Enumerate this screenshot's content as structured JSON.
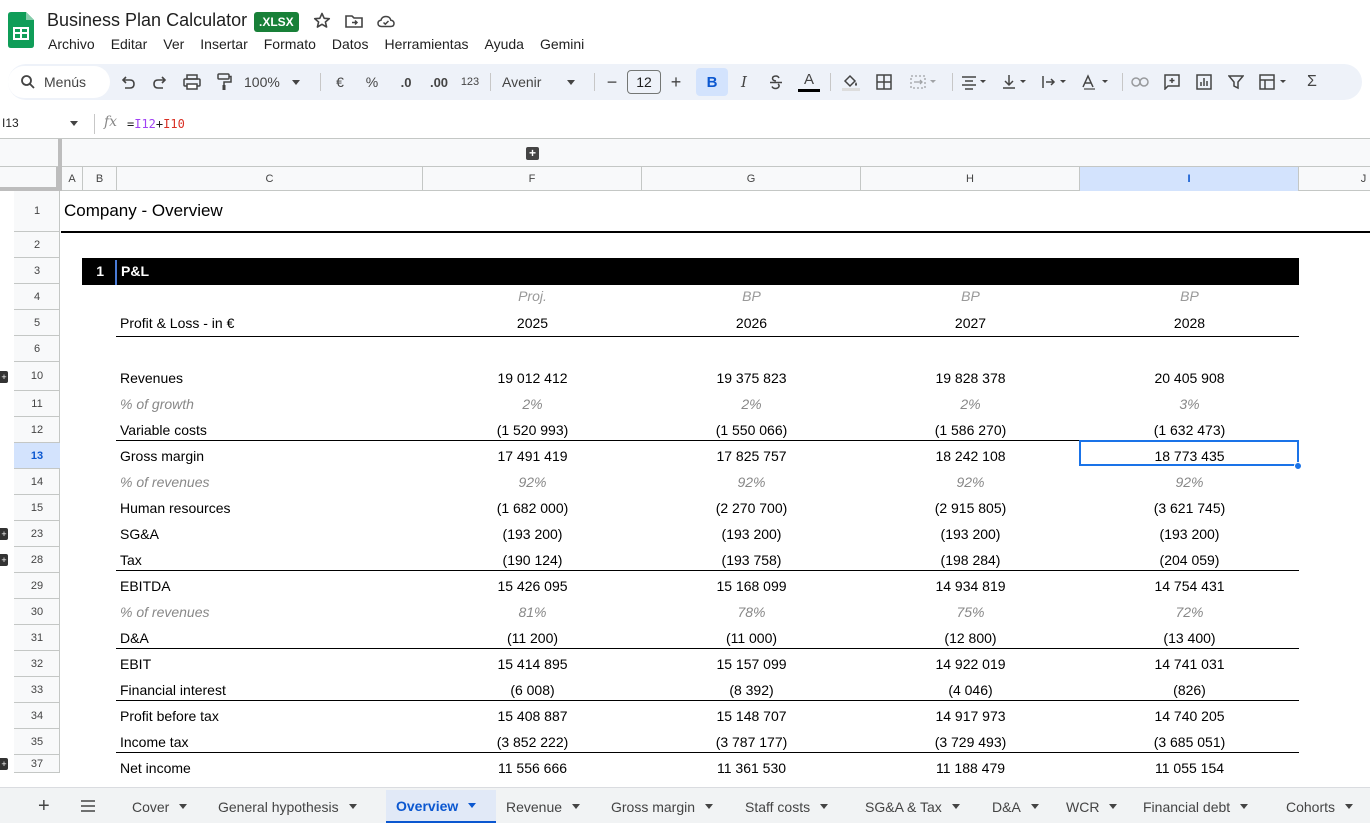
{
  "doc": {
    "title": "Business Plan Calculator",
    "badge": ".XLSX"
  },
  "menu": [
    "Archivo",
    "Editar",
    "Ver",
    "Insertar",
    "Formato",
    "Datos",
    "Herramientas",
    "Ayuda",
    "Gemini"
  ],
  "toolbar": {
    "menus_label": "Menús",
    "zoom": "100%",
    "currency": "€",
    "percent": "%",
    "dec_decrease": ".0",
    "dec_increase": ".00",
    "number_format": "123",
    "font": "Avenir",
    "font_size": "12",
    "minus": "−",
    "plus": "+",
    "bold": "B",
    "italic": "I",
    "text_color_letter": "A",
    "sum": "Σ"
  },
  "formula_bar": {
    "cell_ref": "I13",
    "fx": "fx",
    "formula_prefix": "=",
    "ref1": "I12",
    "op": "+",
    "ref2": "I10"
  },
  "columns": [
    "A",
    "B",
    "C",
    "F",
    "G",
    "H",
    "I",
    "J"
  ],
  "rows": [
    "1",
    "2",
    "3",
    "4",
    "5",
    "6",
    "10",
    "11",
    "12",
    "13",
    "14",
    "15",
    "23",
    "28",
    "29",
    "30",
    "31",
    "32",
    "33",
    "34",
    "35",
    "37"
  ],
  "sheet": {
    "title": "Company - Overview",
    "section_number": "1",
    "section_title": "P&L",
    "table_label": "Profit & Loss - in €",
    "period_types": [
      "Proj.",
      "BP",
      "BP",
      "BP"
    ],
    "years": [
      "2025",
      "2026",
      "2027",
      "2028"
    ],
    "lines": [
      {
        "label": "Revenues",
        "values": [
          "19 012 412",
          "19 375 823",
          "19 828 378",
          "20 405 908"
        ]
      },
      {
        "label": "% of growth",
        "values": [
          "2%",
          "2%",
          "2%",
          "3%"
        ]
      },
      {
        "label": "Variable costs",
        "values": [
          "(1 520 993)",
          "(1 550 066)",
          "(1 586 270)",
          "(1 632 473)"
        ]
      },
      {
        "label": "Gross margin",
        "values": [
          "17 491 419",
          "17 825 757",
          "18 242 108",
          "18 773 435"
        ]
      },
      {
        "label": "% of revenues",
        "values": [
          "92%",
          "92%",
          "92%",
          "92%"
        ]
      },
      {
        "label": "Human resources",
        "values": [
          "(1 682 000)",
          "(2 270 700)",
          "(2 915 805)",
          "(3 621 745)"
        ]
      },
      {
        "label": "SG&A",
        "values": [
          "(193 200)",
          "(193 200)",
          "(193 200)",
          "(193 200)"
        ]
      },
      {
        "label": "Tax",
        "values": [
          "(190 124)",
          "(193 758)",
          "(198 284)",
          "(204 059)"
        ]
      },
      {
        "label": "EBITDA",
        "values": [
          "15 426 095",
          "15 168 099",
          "14 934 819",
          "14 754 431"
        ]
      },
      {
        "label": "% of revenues",
        "values": [
          "81%",
          "78%",
          "75%",
          "72%"
        ]
      },
      {
        "label": "D&A",
        "values": [
          "(11 200)",
          "(11 000)",
          "(12 800)",
          "(13 400)"
        ]
      },
      {
        "label": "EBIT",
        "values": [
          "15 414 895",
          "15 157 099",
          "14 922 019",
          "14 741 031"
        ]
      },
      {
        "label": "Financial interest",
        "values": [
          "(6 008)",
          "(8 392)",
          "(4 046)",
          "(826)"
        ]
      },
      {
        "label": "Profit before tax",
        "values": [
          "15 408 887",
          "15 148 707",
          "14 917 973",
          "14 740 205"
        ]
      },
      {
        "label": "Income tax",
        "values": [
          "(3 852 222)",
          "(3 787 177)",
          "(3 729 493)",
          "(3 685 051)"
        ]
      },
      {
        "label": "Net income",
        "values": [
          "11 556 666",
          "11 361 530",
          "11 188 479",
          "11 055 154"
        ]
      }
    ]
  },
  "tabs": [
    "Cover",
    "General hypothesis",
    "Overview",
    "Revenue",
    "Gross margin",
    "Staff costs",
    "SG&A & Tax",
    "D&A",
    "WCR",
    "Financial debt",
    "Cohorts"
  ],
  "active_tab": "Overview",
  "colors": {
    "accent": "#0b57d0",
    "selection": "#1a73e8",
    "sheets_green": "#188038",
    "section_bg": "#000000"
  }
}
